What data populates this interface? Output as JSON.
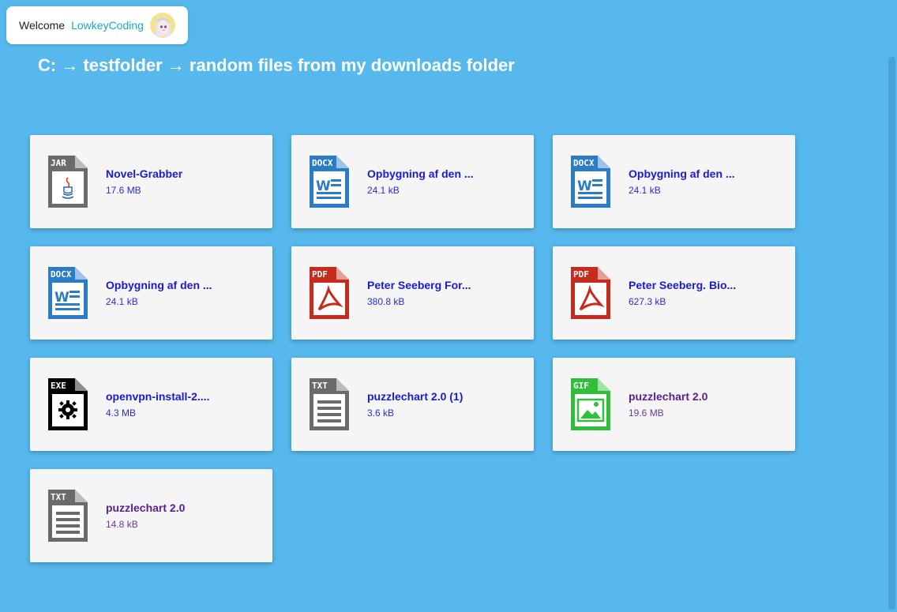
{
  "header": {
    "welcome_label": "Welcome",
    "username": "LowkeyCoding",
    "avatar_icon": "anime-avatar-icon"
  },
  "breadcrumb": {
    "path": "C: → testfolder → random files from my downloads folder"
  },
  "files": [
    {
      "name": "Novel-Grabber",
      "size": "17.6 MB",
      "type": "JAR",
      "icon": "jar-file-icon",
      "color": "#6b6b6b",
      "visited": false
    },
    {
      "name": "Opbygning af den ...",
      "size": "24.1 kB",
      "type": "DOCX",
      "icon": "docx-file-icon",
      "color": "#2a7bc8",
      "visited": false
    },
    {
      "name": "Opbygning af den ...",
      "size": "24.1 kB",
      "type": "DOCX",
      "icon": "docx-file-icon",
      "color": "#2a7bc8",
      "visited": false
    },
    {
      "name": "Opbygning af den ...",
      "size": "24.1 kB",
      "type": "DOCX",
      "icon": "docx-file-icon",
      "color": "#2a7bc8",
      "visited": false
    },
    {
      "name": "Peter Seeberg For...",
      "size": "380.8 kB",
      "type": "PDF",
      "icon": "pdf-file-icon",
      "color": "#c62b1e",
      "visited": false
    },
    {
      "name": "Peter Seeberg. Bio...",
      "size": "627.3 kB",
      "type": "PDF",
      "icon": "pdf-file-icon",
      "color": "#c62b1e",
      "visited": false
    },
    {
      "name": "openvpn-install-2....",
      "size": "4.3 MB",
      "type": "EXE",
      "icon": "exe-file-icon",
      "color": "#000000",
      "visited": false
    },
    {
      "name": "puzzlechart 2.0 (1)",
      "size": "3.6 kB",
      "type": "TXT",
      "icon": "txt-file-icon",
      "color": "#6b6b6b",
      "visited": false
    },
    {
      "name": "puzzlechart 2.0",
      "size": "19.6 MB",
      "type": "GIF",
      "icon": "gif-file-icon",
      "color": "#2fbf3a",
      "visited": true
    },
    {
      "name": "puzzlechart 2.0",
      "size": "14.8 kB",
      "type": "TXT",
      "icon": "txt-file-icon",
      "color": "#6b6b6b",
      "visited": true
    }
  ]
}
